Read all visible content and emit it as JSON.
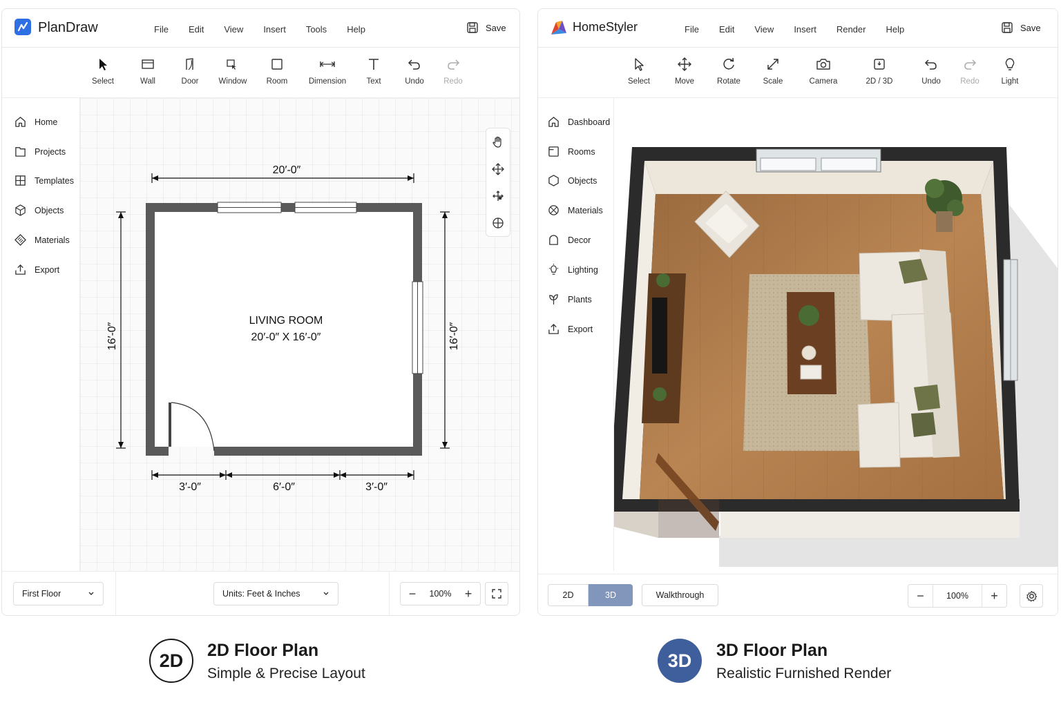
{
  "left": {
    "app_name": "PlanDraw",
    "menu": [
      "File",
      "Edit",
      "View",
      "Insert",
      "Tools",
      "Help"
    ],
    "save_label": "Save",
    "tools": [
      {
        "label": "Select",
        "icon": "cursor-arrow-icon"
      },
      {
        "label": "Wall",
        "icon": "wall-icon"
      },
      {
        "label": "Door",
        "icon": "door-icon"
      },
      {
        "label": "Window",
        "icon": "window-icon"
      },
      {
        "label": "Room",
        "icon": "room-icon"
      },
      {
        "label": "Dimension",
        "icon": "dimension-icon"
      },
      {
        "label": "Text",
        "icon": "text-icon"
      },
      {
        "label": "Undo",
        "icon": "undo-icon"
      },
      {
        "label": "Redo",
        "icon": "redo-icon",
        "disabled": true
      }
    ],
    "sidebar": [
      {
        "label": "Home",
        "icon": "home-icon"
      },
      {
        "label": "Projects",
        "icon": "folder-icon"
      },
      {
        "label": "Templates",
        "icon": "templates-icon"
      },
      {
        "label": "Objects",
        "icon": "cube-icon"
      },
      {
        "label": "Materials",
        "icon": "materials-icon"
      },
      {
        "label": "Export",
        "icon": "export-icon"
      }
    ],
    "plan": {
      "room_name": "LIVING ROOM",
      "room_size": "20′-0″ X 16′-0″",
      "dim_top": "20′-0″",
      "dim_left": "16′-0″",
      "dim_right": "16′-0″",
      "dim_bottom": [
        "3′-0″",
        "6′-0″",
        "3′-0″"
      ]
    },
    "floor_select": "First Floor",
    "units_select": "Units: Feet & Inches",
    "zoom": "100%"
  },
  "right": {
    "app_name": "HomeStyler",
    "menu": [
      "File",
      "Edit",
      "View",
      "Insert",
      "Render",
      "Help"
    ],
    "save_label": "Save",
    "tools": [
      {
        "label": "Select",
        "icon": "cursor-arrow-icon"
      },
      {
        "label": "Move",
        "icon": "move-icon"
      },
      {
        "label": "Rotate",
        "icon": "rotate-icon"
      },
      {
        "label": "Scale",
        "icon": "scale-icon"
      },
      {
        "label": "Camera",
        "icon": "camera-icon"
      },
      {
        "label": "2D / 3D",
        "icon": "toggle-2d3d-icon"
      },
      {
        "label": "Undo",
        "icon": "undo-icon"
      },
      {
        "label": "Redo",
        "icon": "redo-icon",
        "disabled": true
      },
      {
        "label": "Light",
        "icon": "lightbulb-icon"
      }
    ],
    "sidebar": [
      {
        "label": "Dashboard",
        "icon": "home-icon"
      },
      {
        "label": "Rooms",
        "icon": "rooms-icon"
      },
      {
        "label": "Objects",
        "icon": "cube-icon"
      },
      {
        "label": "Materials",
        "icon": "materials-icon"
      },
      {
        "label": "Decor",
        "icon": "decor-icon"
      },
      {
        "label": "Lighting",
        "icon": "lightbulb-icon"
      },
      {
        "label": "Plants",
        "icon": "plant-icon"
      },
      {
        "label": "Export",
        "icon": "export-icon"
      }
    ],
    "view_tabs": [
      "2D",
      "3D"
    ],
    "active_view": "3D",
    "walkthrough_label": "Walkthrough",
    "zoom": "100%"
  },
  "captions": [
    {
      "badge": "2D",
      "title": "2D Floor Plan",
      "subtitle": "Simple & Precise Layout"
    },
    {
      "badge": "3D",
      "title": "3D Floor Plan",
      "subtitle": "Realistic Furnished Render"
    }
  ],
  "colors": {
    "plandraw_logo": "#2f6fe4",
    "wall": "#5a5a5a",
    "active_tab": "#8296bb",
    "badge_3d": "#3f5f9c",
    "floor_wood": "#b07a4a",
    "sofa": "#ece7df",
    "wall_3d": "#2b2b2b"
  }
}
